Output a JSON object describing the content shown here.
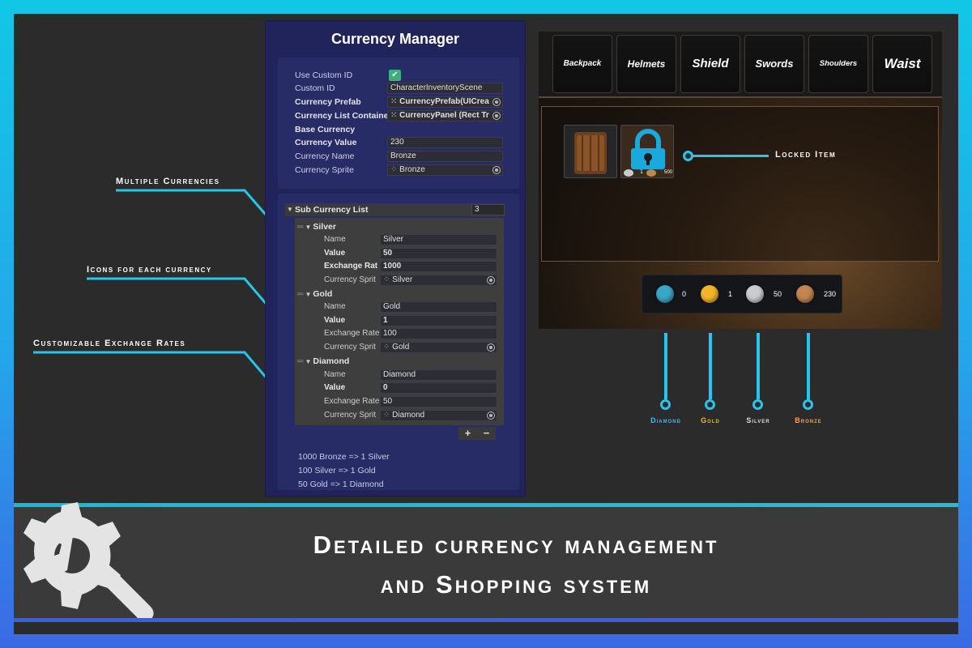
{
  "inspector": {
    "title": "Currency Manager",
    "use_custom_id_label": "Use Custom ID",
    "use_custom_id_checked": true,
    "custom_id_label": "Custom ID",
    "custom_id_value": "CharacterInventoryScene",
    "currency_prefab_label": "Currency Prefab",
    "currency_prefab_value": "CurrencyPrefab(UICrea",
    "currency_list_container_label": "Currency List Containe",
    "currency_list_container_value": "CurrencyPanel (Rect Tr",
    "base_currency_label": "Base Currency",
    "currency_value_label": "Currency Value",
    "currency_value": "230",
    "currency_name_label": "Currency Name",
    "currency_name_value": "Bronze",
    "currency_sprite_label": "Currency Sprite",
    "currency_sprite_value": "Bronze",
    "sub_currency_list_label": "Sub Currency List",
    "sub_currency_count": "3",
    "sub_currencies": [
      {
        "header": "Silver",
        "name_label": "Name",
        "name": "Silver",
        "value_label": "Value",
        "value": "50",
        "rate_label": "Exchange Rat",
        "rate": "1000",
        "sprite_label": "Currency Sprit",
        "sprite": "Silver",
        "rate_bold": true
      },
      {
        "header": "Gold",
        "name_label": "Name",
        "name": "Gold",
        "value_label": "Value",
        "value": "1",
        "rate_label": "Exchange Rate",
        "rate": "100",
        "sprite_label": "Currency Sprit",
        "sprite": "Gold",
        "rate_bold": false
      },
      {
        "header": "Diamond",
        "name_label": "Name",
        "name": "Diamond",
        "value_label": "Value",
        "value": "0",
        "rate_label": "Exchange Rate",
        "rate": "50",
        "sprite_label": "Currency Sprit",
        "sprite": "Diamond",
        "rate_bold": false
      }
    ],
    "add_label": "+",
    "remove_label": "−",
    "notes": [
      "1000 Bronze => 1 Silver",
      "100 Silver => 1 Gold",
      "50 Gold => 1 Diamond"
    ]
  },
  "callouts": {
    "multiple": "Multiple Currencies",
    "icons": "Icons for each currency",
    "rates": "Customizable Exchange Rates",
    "locked": "Locked Item"
  },
  "game": {
    "tabs": [
      "Backpack",
      "Helmets",
      "Shield",
      "Swords",
      "Shoulders",
      "Waist"
    ],
    "locked_item_price_small": "1",
    "locked_item_price_large": "500",
    "coins": [
      {
        "name": "diamond",
        "amount": "0",
        "color": "#3aa7c9"
      },
      {
        "name": "gold",
        "amount": "1",
        "color": "#f2b52a"
      },
      {
        "name": "silver",
        "amount": "50",
        "color": "#c9cbcf"
      },
      {
        "name": "bronze",
        "amount": "230",
        "color": "#c48552"
      }
    ]
  },
  "legend": [
    {
      "label": "Diamond",
      "color": "#27c4ec"
    },
    {
      "label": "Gold",
      "color": "#f2b52a"
    },
    {
      "label": "Silver",
      "color": "#dcdcdc"
    },
    {
      "label": "Bronze",
      "color": "#f0a35a"
    }
  ],
  "banner": {
    "line1": "Detailed currency management",
    "line2": "and Shopping system",
    "icon": "gear-wrench-icon"
  },
  "colors": {
    "accent": "#27c4ec",
    "inspector_bg": "#21245a",
    "checkbox": "#3bb07c"
  }
}
